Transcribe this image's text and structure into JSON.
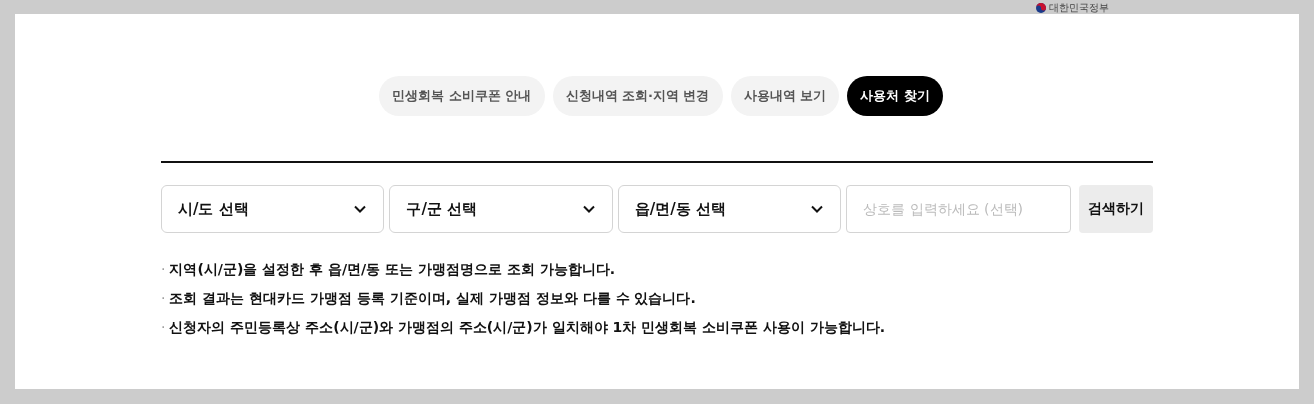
{
  "header": {
    "logo_text": "대한민국정부"
  },
  "tabs": [
    {
      "label": "민생회복 소비쿠폰 안내",
      "selected": false
    },
    {
      "label": "신청내역 조회·지역 변경",
      "selected": false
    },
    {
      "label": "사용내역 보기",
      "selected": false
    },
    {
      "label": "사용처 찾기",
      "selected": true
    }
  ],
  "filters": [
    {
      "label": "시/도 선택"
    },
    {
      "label": "구/군 선택"
    },
    {
      "label": "읍/면/동 선택"
    }
  ],
  "search": {
    "placeholder": "상호를 입력하세요 (선택)",
    "button": "검색하기"
  },
  "notes": [
    {
      "bullet": "·",
      "text": "지역(시/군)을 설정한 후 읍/면/동 또는 가맹점명으로 조회 가능합니다."
    },
    {
      "bullet": "·",
      "text": "조회 결과는 현대카드 가맹점 등록 기준이며, 실제 가맹점 정보와 다를 수 있습니다."
    },
    {
      "bullet": "·",
      "text": "신청자의 주민등록상 주소(시/군)와 가맹점의 주소(시/군)가 일치해야 1차 민생회복 소비쿠폰 사용이 가능합니다."
    }
  ]
}
